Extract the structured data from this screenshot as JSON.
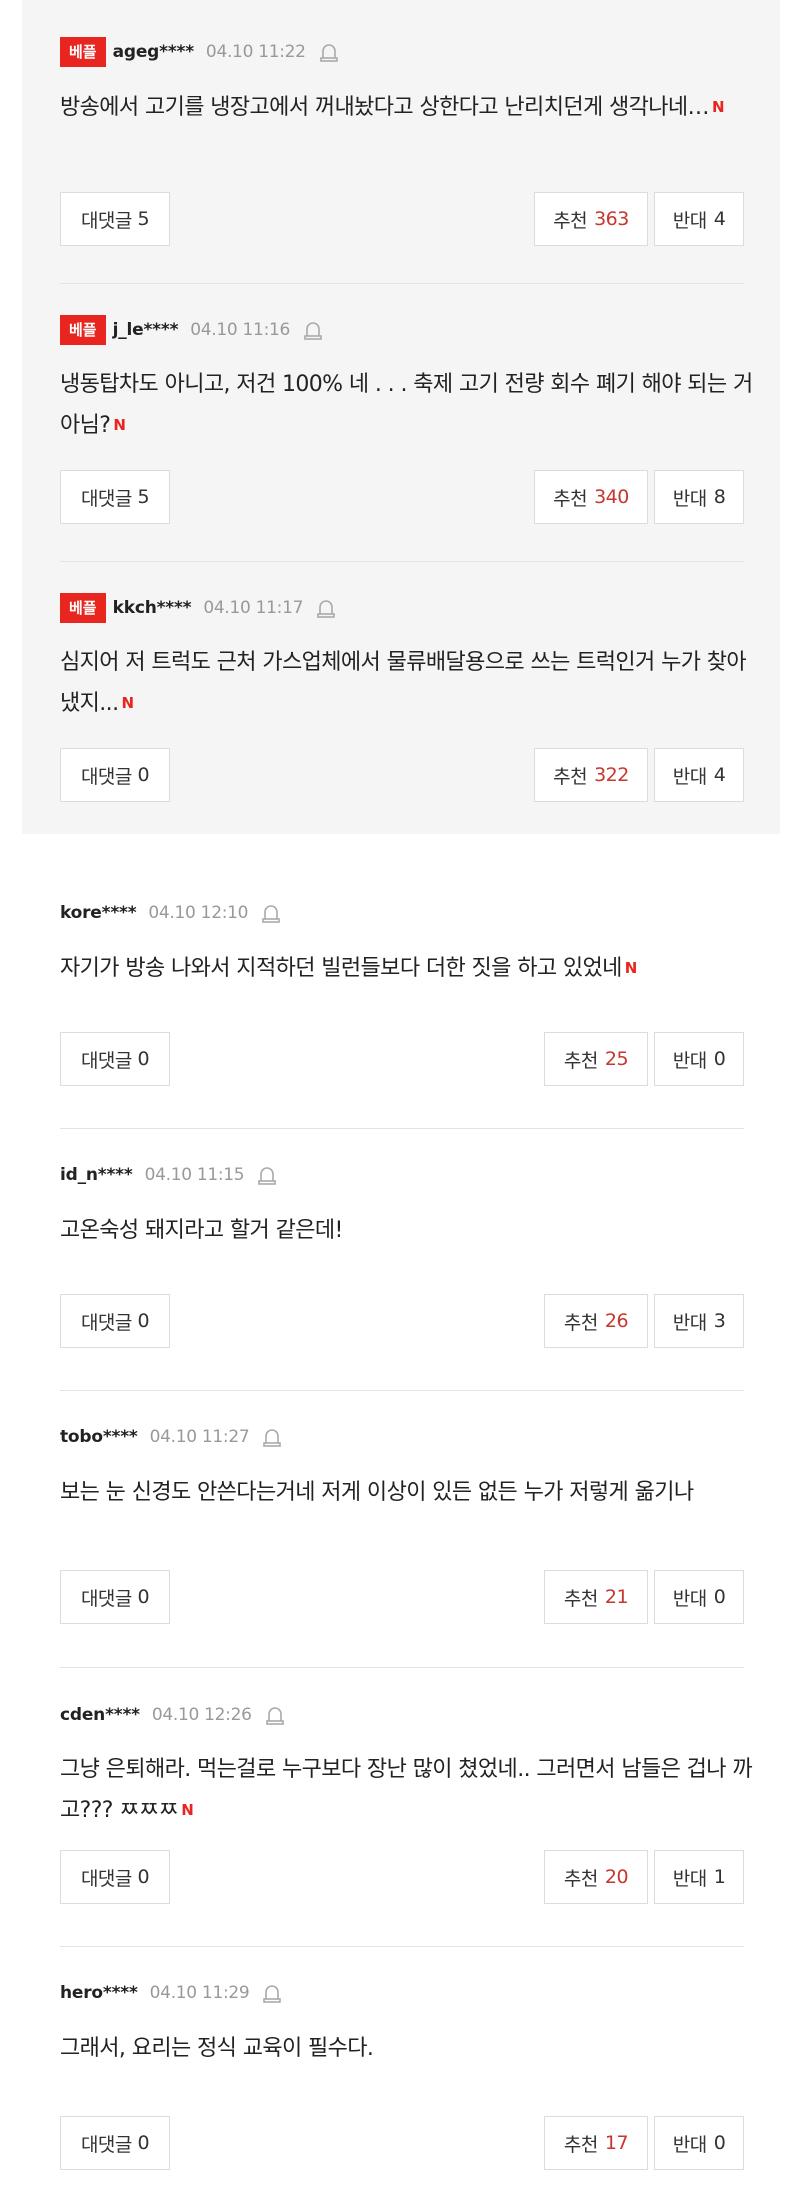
{
  "labels": {
    "best": "베플",
    "reply": "대댓글",
    "up": "추천",
    "down": "반대"
  },
  "colors": {
    "best_badge": "#e8251f",
    "new_mark": "#e8251f",
    "up_count": "#c8372f",
    "best_bg": "#f5f5f5"
  },
  "best_comments": [
    {
      "nick": "ageg****",
      "date": "04.10 11:22",
      "text": "방송에서 고기를 냉장고에서 꺼내놨다고 상한다고 난리치던게 생각나네…",
      "new": "N",
      "replies": "5",
      "up": "363",
      "down": "4"
    },
    {
      "nick": "j_le****",
      "date": "04.10 11:16",
      "text": "냉동탑차도 아니고, 저건 100% 네 . . . 축제 고기 전량 회수 폐기 해야 되는 거 아님?",
      "new": "N",
      "replies": "5",
      "up": "340",
      "down": "8"
    },
    {
      "nick": "kkch****",
      "date": "04.10 11:17",
      "text": "심지어 저 트럭도 근처 가스업체에서 물류배달용으로 쓰는 트럭인거 누가 찾아냈지...",
      "new": "N",
      "replies": "0",
      "up": "322",
      "down": "4"
    }
  ],
  "comments": [
    {
      "nick": "kore****",
      "date": "04.10 12:10",
      "text": "자기가 방송 나와서 지적하던 빌런들보다 더한 짓을 하고 있었네",
      "new": "N",
      "replies": "0",
      "up": "25",
      "down": "0"
    },
    {
      "nick": "id_n****",
      "date": "04.10 11:15",
      "text": "고온숙성 돼지라고 할거 같은데!",
      "new": "",
      "replies": "0",
      "up": "26",
      "down": "3"
    },
    {
      "nick": "tobo****",
      "date": "04.10 11:27",
      "text": "보는 눈 신경도 안쓴다는거네 저게 이상이 있든 없든 누가 저렇게 옮기나",
      "new": "",
      "replies": "0",
      "up": "21",
      "down": "0"
    },
    {
      "nick": "cden****",
      "date": "04.10 12:26",
      "text": "그냥 은퇴해라. 먹는걸로 누구보다 장난 많이 쳤었네.. 그러면서 남들은 겁나 까고??? ㅉㅉㅉ",
      "new": "N",
      "replies": "0",
      "up": "20",
      "down": "1"
    },
    {
      "nick": "hero****",
      "date": "04.10 11:29",
      "text": "그래서, 요리는 정식 교육이 필수다.",
      "new": "",
      "replies": "0",
      "up": "17",
      "down": "0"
    }
  ]
}
